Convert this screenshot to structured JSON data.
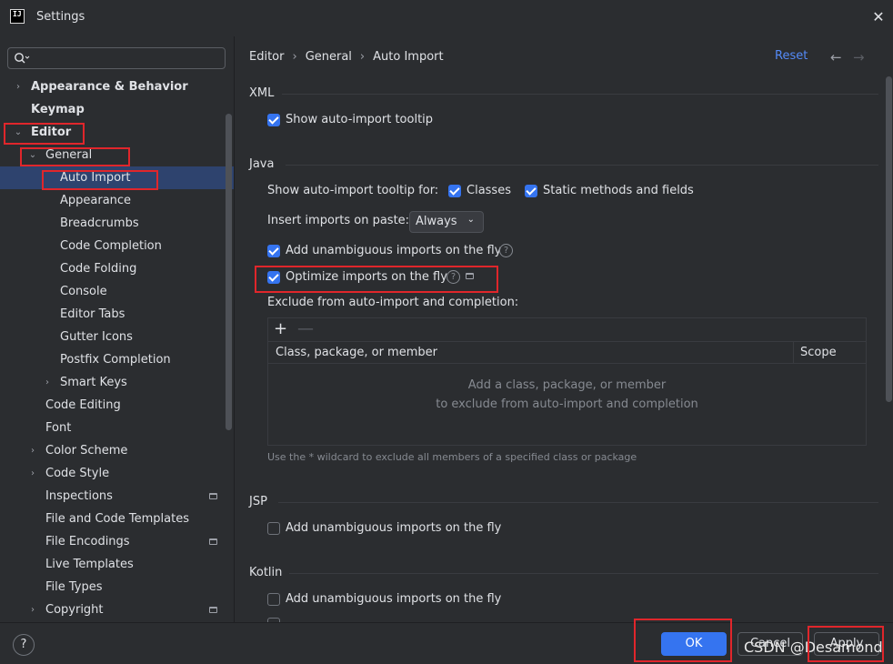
{
  "window": {
    "title": "Settings",
    "close_glyph": "✕",
    "logo_text": "IJ"
  },
  "search": {
    "placeholder": "",
    "value": ""
  },
  "sidebar": {
    "items": [
      {
        "label": "Appearance & Behavior",
        "depth": 0,
        "chevron": "›",
        "bold": true
      },
      {
        "label": "Keymap",
        "depth": 0,
        "chevron": "",
        "bold": true
      },
      {
        "label": "Editor",
        "depth": 0,
        "chevron": "⌄",
        "bold": true
      },
      {
        "label": "General",
        "depth": 1,
        "chevron": "⌄"
      },
      {
        "label": "Auto Import",
        "depth": 2,
        "chevron": "",
        "selected": true
      },
      {
        "label": "Appearance",
        "depth": 2,
        "chevron": ""
      },
      {
        "label": "Breadcrumbs",
        "depth": 2,
        "chevron": ""
      },
      {
        "label": "Code Completion",
        "depth": 2,
        "chevron": ""
      },
      {
        "label": "Code Folding",
        "depth": 2,
        "chevron": ""
      },
      {
        "label": "Console",
        "depth": 2,
        "chevron": ""
      },
      {
        "label": "Editor Tabs",
        "depth": 2,
        "chevron": ""
      },
      {
        "label": "Gutter Icons",
        "depth": 2,
        "chevron": ""
      },
      {
        "label": "Postfix Completion",
        "depth": 2,
        "chevron": ""
      },
      {
        "label": "Smart Keys",
        "depth": 2,
        "chevron": "›"
      },
      {
        "label": "Code Editing",
        "depth": 1,
        "chevron": ""
      },
      {
        "label": "Font",
        "depth": 1,
        "chevron": ""
      },
      {
        "label": "Color Scheme",
        "depth": 1,
        "chevron": "›"
      },
      {
        "label": "Code Style",
        "depth": 1,
        "chevron": "›"
      },
      {
        "label": "Inspections",
        "depth": 1,
        "chevron": "",
        "project_icon": true
      },
      {
        "label": "File and Code Templates",
        "depth": 1,
        "chevron": ""
      },
      {
        "label": "File Encodings",
        "depth": 1,
        "chevron": "",
        "project_icon": true
      },
      {
        "label": "Live Templates",
        "depth": 1,
        "chevron": ""
      },
      {
        "label": "File Types",
        "depth": 1,
        "chevron": ""
      },
      {
        "label": "Copyright",
        "depth": 1,
        "chevron": "›",
        "project_icon": true
      }
    ]
  },
  "header": {
    "breadcrumbs": [
      "Editor",
      "General",
      "Auto Import"
    ],
    "separator": "›",
    "reset_label": "Reset",
    "back_glyph": "←",
    "forward_glyph": "→"
  },
  "sections": {
    "xml": {
      "title": "XML",
      "show_tooltip": {
        "label": "Show auto-import tooltip",
        "checked": true
      }
    },
    "java": {
      "title": "Java",
      "tooltip_for_label": "Show auto-import tooltip for:",
      "classes": {
        "label": "Classes",
        "checked": true
      },
      "static_methods": {
        "label": "Static methods and fields",
        "checked": true
      },
      "insert_on_paste_label": "Insert imports on paste:",
      "insert_on_paste_value": "Always",
      "add_unambiguous": {
        "label": "Add unambiguous imports on the fly",
        "checked": true
      },
      "optimize": {
        "label": "Optimize imports on the fly",
        "checked": true
      },
      "exclude_label": "Exclude from auto-import and completion:",
      "toolbar": {
        "add_glyph": "+",
        "remove_glyph": "—"
      },
      "columns": [
        "Class, package, or member",
        "Scope"
      ],
      "empty_line1": "Add a class, package, or member",
      "empty_line2": "to exclude from auto-import and completion",
      "hint": "Use the * wildcard to exclude all members of a specified class or package"
    },
    "jsp": {
      "title": "JSP",
      "add_unambiguous": {
        "label": "Add unambiguous imports on the fly",
        "checked": false
      }
    },
    "kotlin": {
      "title": "Kotlin",
      "add_unambiguous": {
        "label": "Add unambiguous imports on the fly",
        "checked": false
      }
    }
  },
  "footer": {
    "help_glyph": "?",
    "ok_label": "OK",
    "cancel_label": "Cancel",
    "apply_label": "Apply",
    "watermark": "CSDN @Desamond"
  },
  "colors": {
    "background": "#2b2d30",
    "accent": "#3574f0",
    "selection": "#2e436e",
    "highlight_box": "#e0262b",
    "link": "#548af7"
  }
}
